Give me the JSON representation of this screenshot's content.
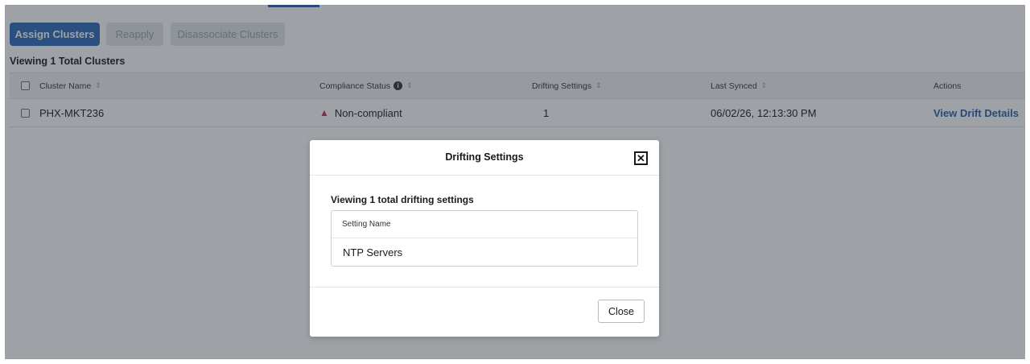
{
  "toolbar": {
    "assign_label": "Assign Clusters",
    "reapply_label": "Reapply",
    "disassociate_label": "Disassociate Clusters"
  },
  "summary": {
    "viewing_total": "Viewing 1 Total Clusters"
  },
  "table": {
    "columns": {
      "cluster_name": "Cluster Name",
      "compliance_status": "Compliance Status",
      "drifting_settings": "Drifting Settings",
      "last_synced": "Last Synced",
      "actions": "Actions"
    },
    "rows": [
      {
        "cluster_name": "PHX-MKT236",
        "compliance_status": "Non-compliant",
        "drifting_settings": "1",
        "last_synced": "06/02/26, 12:13:30 PM",
        "action_link": "View Drift Details"
      }
    ]
  },
  "modal": {
    "title": "Drifting Settings",
    "subtitle": "Viewing 1 total drifting settings",
    "column_header": "Setting Name",
    "rows": [
      "NTP Servers"
    ],
    "close_label": "Close",
    "close_x": "✕"
  },
  "icons": {
    "sort": "⇕",
    "info": "i",
    "warning": "▲"
  },
  "colors": {
    "primary": "#2a6ab8",
    "link": "#2a5fa8",
    "warning": "#c4314b"
  }
}
